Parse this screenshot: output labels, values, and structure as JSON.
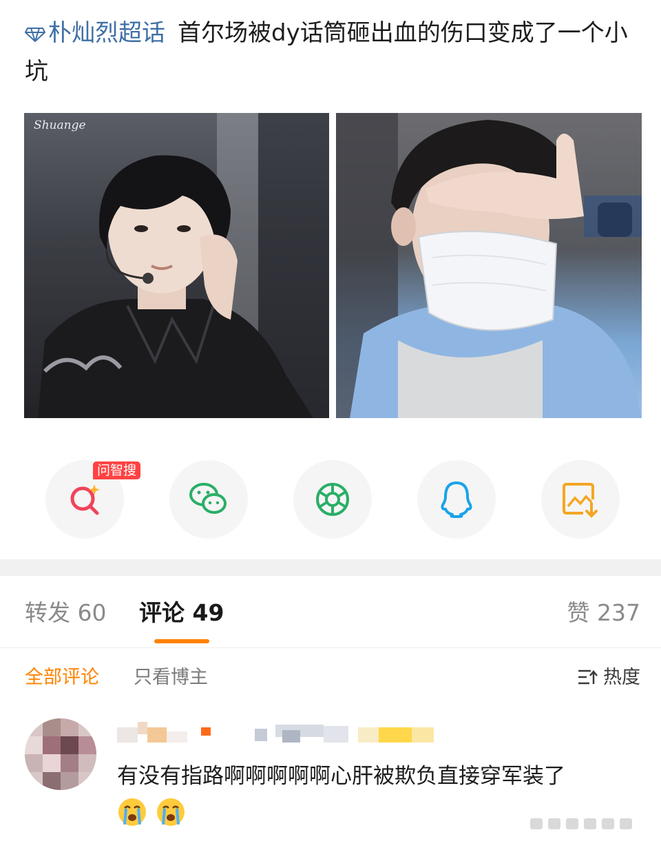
{
  "post": {
    "topic": "朴灿烈超话",
    "text": "首尔场被dy话筒砸出血的伤口变成了一个小坑"
  },
  "photos": {
    "left_watermark": "Shuange"
  },
  "share": {
    "ai_badge": "问智搜",
    "icons": [
      "ai-search-icon",
      "wechat-icon",
      "moments-icon",
      "qq-icon",
      "save-image-icon"
    ],
    "colors": {
      "ai": "#f0445a",
      "wechat": "#2aae67",
      "moments": "#2aae67",
      "qq": "#1aa3e8",
      "save": "#f5a623"
    }
  },
  "tabs": {
    "repost": "转发 60",
    "comment": "评论 49",
    "like": "赞 237",
    "accent": "#ff8200"
  },
  "filters": {
    "all": "全部评论",
    "owner_only": "只看博主",
    "sort": "热度"
  },
  "comment": {
    "text": "有没有指路啊啊啊啊啊心肝被欺负直接穿军装了",
    "emoji": [
      "crying-face-icon",
      "crying-face-icon"
    ]
  }
}
